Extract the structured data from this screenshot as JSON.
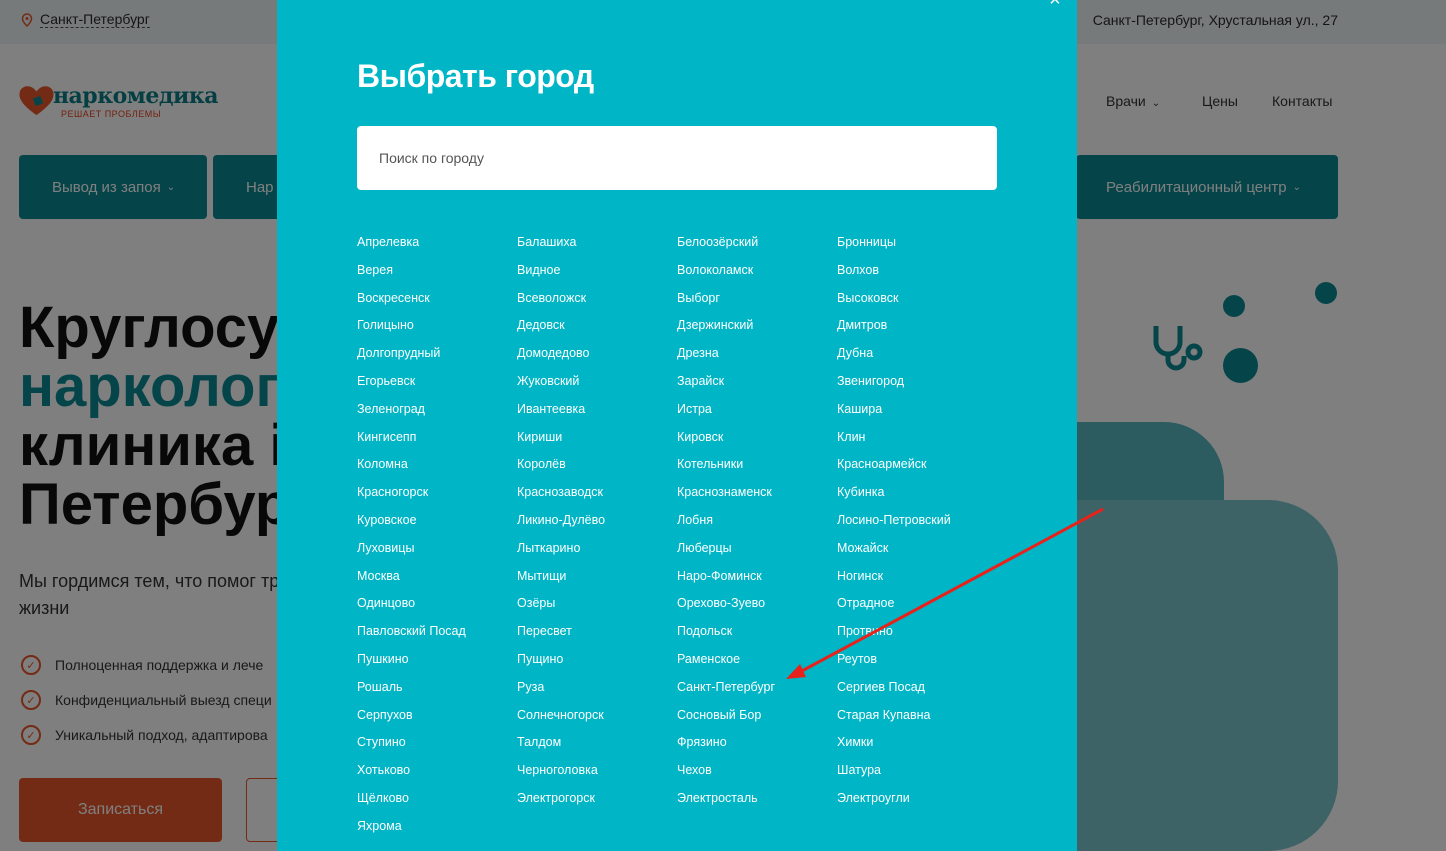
{
  "topbar": {
    "current_city": "Санкт-Петербург",
    "address": "Санкт-Петербург, Хрустальная ул., 27"
  },
  "logo": {
    "brand": "наркомедика",
    "slogan": "РЕШАЕТ ПРОБЛЕМЫ"
  },
  "nav": {
    "doctors": "Врачи",
    "prices": "Цены",
    "contacts": "Контакты"
  },
  "services": {
    "btn1": "Вывод из запоя",
    "btn2": "Нар",
    "btn3": "Реабилитационный центр"
  },
  "hero": {
    "line1": "Круглосу",
    "line2": "нарколог",
    "line3": "клиника і",
    "line4": "Петербур",
    "subtitle": "Мы гордимся тем, что помог трезвой жизни",
    "features": [
      "Полноценная поддержка и лече",
      "Конфиденциальный выезд специ",
      "Уникальный подход, адаптирова"
    ],
    "cta": "Записаться"
  },
  "modal": {
    "title": "Выбрать город",
    "search_placeholder": "Поиск по городу",
    "close": "×",
    "cities": [
      "Апрелевка",
      "Балашиха",
      "Белоозёрский",
      "Бронницы",
      "Верея",
      "Видное",
      "Волоколамск",
      "Волхов",
      "Воскресенск",
      "Всеволожск",
      "Выборг",
      "Высоковск",
      "Голицыно",
      "Дедовск",
      "Дзержинский",
      "Дмитров",
      "Долгопрудный",
      "Домодедово",
      "Дрезна",
      "Дубна",
      "Егорьевск",
      "Жуковский",
      "Зарайск",
      "Звенигород",
      "Зеленоград",
      "Ивантеевка",
      "Истра",
      "Кашира",
      "Кингисепп",
      "Кириши",
      "Кировск",
      "Клин",
      "Коломна",
      "Королёв",
      "Котельники",
      "Красноармейск",
      "Красногорск",
      "Краснозаводск",
      "Краснознаменск",
      "Кубинка",
      "Куровское",
      "Ликино-Дулёво",
      "Лобня",
      "Лосино-Петровский",
      "Луховицы",
      "Лыткарино",
      "Люберцы",
      "Можайск",
      "Москва",
      "Мытищи",
      "Наро-Фоминск",
      "Ногинск",
      "Одинцово",
      "Озёры",
      "Орехово-Зуево",
      "Отрадное",
      "Павловский Посад",
      "Пересвет",
      "Подольск",
      "Протвино",
      "Пушкино",
      "Пущино",
      "Раменское",
      "Реутов",
      "Рошаль",
      "Руза",
      "Санкт-Петербург",
      "Сергиев Посад",
      "Серпухов",
      "Солнечногорск",
      "Сосновый Бор",
      "Старая Купавна",
      "Ступино",
      "Талдом",
      "Фрязино",
      "Химки",
      "Хотьково",
      "Черноголовка",
      "Чехов",
      "Шатура",
      "Щёлково",
      "Электрогорск",
      "Электросталь",
      "Электроугли",
      "Яхрома"
    ]
  },
  "colors": {
    "modal_bg": "#00b5c5",
    "brand_teal": "#0a8a94",
    "accent_orange": "#e8572a",
    "arrow_red": "#e8221b"
  }
}
